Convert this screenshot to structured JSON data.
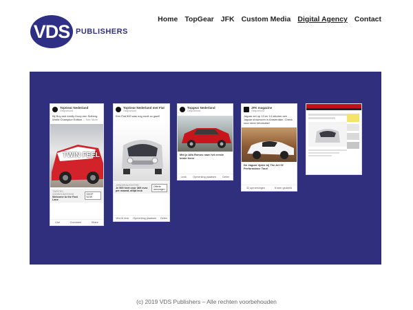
{
  "brand": {
    "logo_mark": "VDS",
    "logo_text": "PUBLISHERS"
  },
  "nav": {
    "items": [
      {
        "label": "Home",
        "active": false
      },
      {
        "label": "TopGear",
        "active": false
      },
      {
        "label": "JFK",
        "active": false
      },
      {
        "label": "Custom Media",
        "active": false
      },
      {
        "label": "Digital Agency",
        "active": true
      },
      {
        "label": "Contact",
        "active": false
      }
    ]
  },
  "cards": [
    {
      "page": "TopGear Nederland",
      "sub": "Gesponsord",
      "text": "Bij Buy and erndly Koop een Solberg World Champion Edition",
      "more": "... See More",
      "overlay": "TWIN FEEL",
      "cta_site": "TWISTED, CONSOLIDATIONS",
      "cta_title": "Welcome to the Fast Lane",
      "cta_btn": "SHOP NOW",
      "actions": [
        "Like",
        "Comment",
        "Share"
      ]
    },
    {
      "page": "TopGear Nederland met Fiat",
      "sub": "Gesponsord",
      "text": "Een Fiat 500 was nog nooit zo gaaf!",
      "cta_site": "JONGERAUTOSTER",
      "cta_title": "Je 500 heet voor 369 euro per maand, altijd leuk",
      "cta_btn": "Offerte aanvragen",
      "actions": [
        "Vind ik leuk",
        "Opmerking plaatsen",
        "Delen"
      ]
    },
    {
      "page": "Topgear Nederland",
      "sub": "Gesponsord",
      "text": "",
      "cta_title": "Met je Alfa Romeo naar het eerste beste feest",
      "actions": [
        "Leuk",
        "Opmerking plaatsen",
        "Delen"
      ]
    },
    {
      "page": "JFK magazine",
      "sub": "Gesponsord",
      "text": "Jaguar zet op 13 en 14 oktober een Jaguar showroom in Amsterdam. Check voor meer informatie!",
      "cta_title": "De Jaguar rijden bij The Art Of Performance Tour!",
      "actions": [
        "32 opmerkingen",
        "6 keer gedeeld"
      ]
    },
    {
      "page": "",
      "sub": "",
      "text": "",
      "cta_title": "",
      "actions": []
    }
  ],
  "footer": {
    "copyright": "(c) 2019 VDS Publishers – Alle rechten voorbehouden"
  },
  "colors": {
    "brand": "#2f2f85",
    "stage": "#2f2f7e"
  }
}
